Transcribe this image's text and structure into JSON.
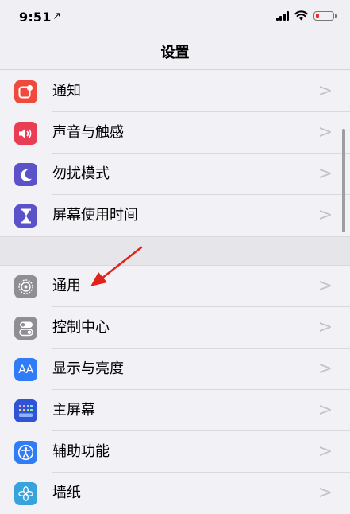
{
  "status": {
    "time": "9:51",
    "location_glyph": "↗",
    "icons": [
      "signal-icon",
      "wifi-icon",
      "battery-low-icon"
    ]
  },
  "nav": {
    "title": "设置"
  },
  "colors": {
    "notifications": "#f04a3e",
    "sounds": "#ea3c53",
    "dnd": "#5b52c9",
    "screentime": "#5b52c9",
    "general": "#8e8e93",
    "control": "#8e8e93",
    "display": "#2f7cf6",
    "home": "#2f55d6",
    "access": "#2f7cf6",
    "wallpaper": "#37a3dc"
  },
  "group1": [
    {
      "label": "通知",
      "icon": "notifications-icon"
    },
    {
      "label": "声音与触感",
      "icon": "sound-icon"
    },
    {
      "label": "勿扰模式",
      "icon": "moon-icon"
    },
    {
      "label": "屏幕使用时间",
      "icon": "hourglass-icon"
    }
  ],
  "group2": [
    {
      "label": "通用",
      "icon": "gear-icon"
    },
    {
      "label": "控制中心",
      "icon": "toggles-icon"
    },
    {
      "label": "显示与亮度",
      "icon": "text-size-icon",
      "icon_text": "AA"
    },
    {
      "label": "主屏幕",
      "icon": "home-grid-icon"
    },
    {
      "label": "辅助功能",
      "icon": "accessibility-icon"
    },
    {
      "label": "墙纸",
      "icon": "flower-icon"
    }
  ],
  "chevron": ">"
}
